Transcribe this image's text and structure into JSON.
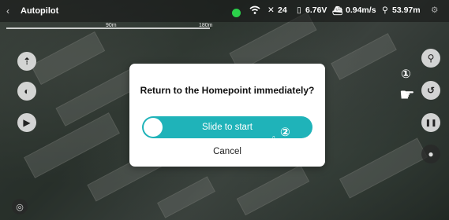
{
  "topbar": {
    "title": "Autopilot",
    "status": {
      "gps_color": "#2bd14a",
      "signal_icon": "wifi-icon",
      "satellites": "24",
      "voltage": "6.76V",
      "speed": "0.94m/s",
      "altitude": "53.97m"
    }
  },
  "scale": {
    "mid": "90m",
    "end": "180m"
  },
  "left_buttons": [
    {
      "icon": "takeoff-icon",
      "glyph": "⇡"
    },
    {
      "icon": "light-icon",
      "glyph": "◐"
    },
    {
      "icon": "land-icon",
      "glyph": "▶"
    }
  ],
  "right_buttons": [
    {
      "icon": "location-pin-icon",
      "glyph": "⚲"
    },
    {
      "icon": "return-home-icon",
      "glyph": "↺"
    },
    {
      "icon": "pause-icon",
      "glyph": "❚❚"
    },
    {
      "icon": "stop-icon",
      "glyph": "●"
    }
  ],
  "bottom_left_icon": "target-icon",
  "dialog": {
    "prompt": "Return to the Homepoint immediately?",
    "slider_label": "Slide to start",
    "cancel_label": "Cancel",
    "accent": "#1fb3b9"
  },
  "annotations": {
    "step1": "①",
    "step2": "②"
  }
}
